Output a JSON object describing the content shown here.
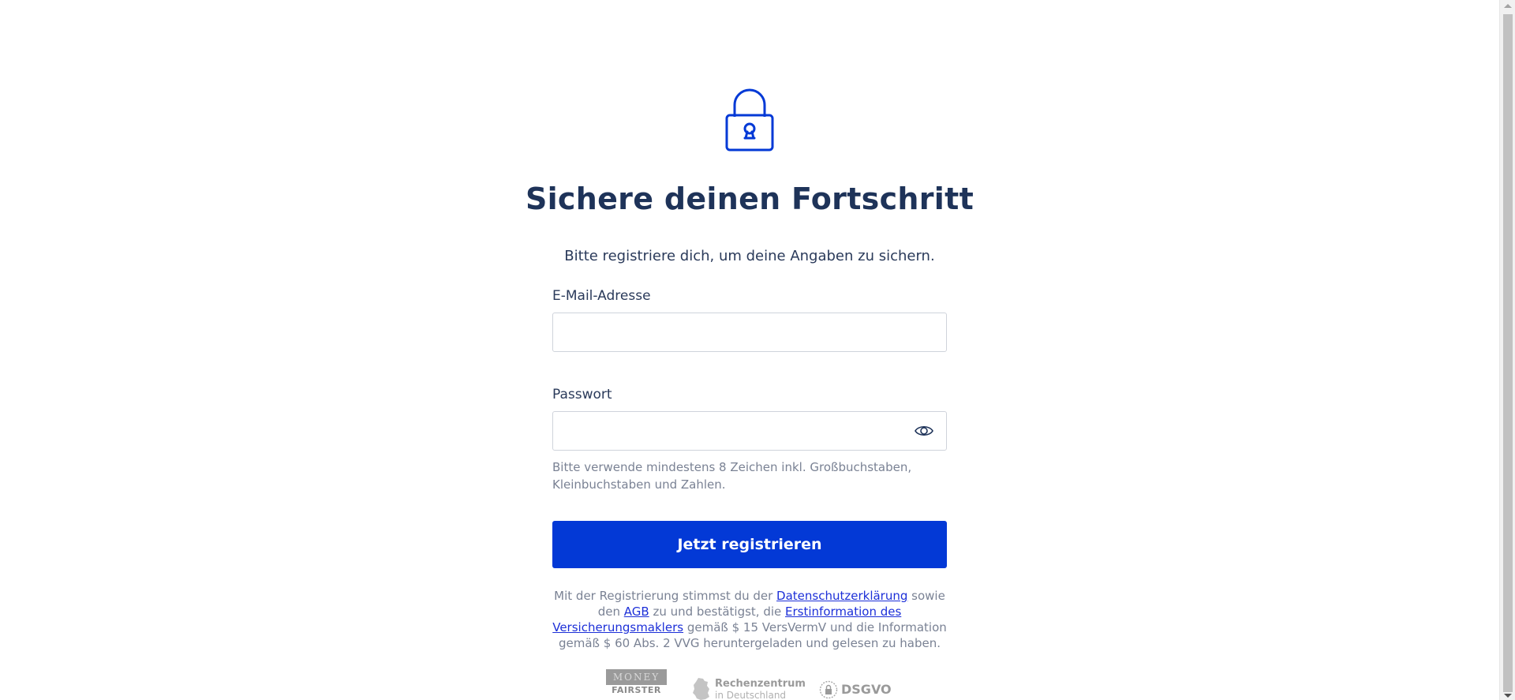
{
  "header": {
    "title": "Sichere deinen Fortschritt",
    "subtitle": "Bitte registriere dich, um deine Angaben zu sichern."
  },
  "form": {
    "email_label": "E-Mail-Adresse",
    "email_value": "",
    "password_label": "Passwort",
    "password_value": "",
    "password_hint": "Bitte verwende mindestens 8 Zeichen inkl. Großbuchstaben, Kleinbuchstaben und Zahlen.",
    "submit_label": "Jetzt registrieren"
  },
  "legal": {
    "text_1": "Mit der Registrierung stimmst du der ",
    "link_privacy": "Datenschutzerklärung",
    "text_2": " sowie den ",
    "link_terms": "AGB",
    "text_3": " zu und bestätigst, die ",
    "link_first_info": "Erstinformation des Versicherungsmaklers",
    "text_4": " gemäß $ 15 VersVermV und die Information gemäß $ 60 Abs. 2 VVG heruntergeladen und gelesen zu haben."
  },
  "badges": {
    "money_top": "MONEY",
    "money_bottom": "FAIRSTER",
    "datacenter_title": "Rechenzentrum",
    "datacenter_sub": "in Deutschland",
    "gdpr": "DSGVO"
  },
  "icons": {
    "lock": "lock-icon",
    "eye": "eye-icon"
  },
  "colors": {
    "primary": "#0339d6",
    "heading": "#1e3359",
    "link": "#1c2fd8",
    "muted": "#7a8294"
  }
}
